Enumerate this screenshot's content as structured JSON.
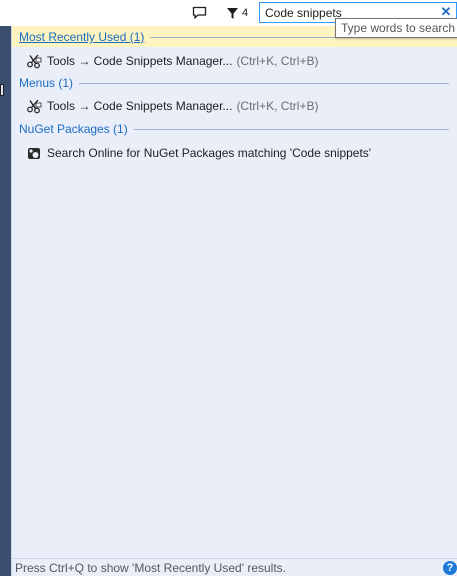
{
  "search": {
    "value": "Code snippets",
    "tooltip": "Type words to search f",
    "notification_count": "4"
  },
  "sections": [
    {
      "title": "Most Recently Used (1)",
      "results": [
        {
          "text": "Tools → Code Snippets Manager...",
          "shortcut": "(Ctrl+K, Ctrl+B)",
          "icon": "snippet-icon"
        }
      ]
    },
    {
      "title": "Menus (1)",
      "results": [
        {
          "text": "Tools → Code Snippets Manager...",
          "shortcut": "(Ctrl+K, Ctrl+B)",
          "icon": "snippet-icon"
        }
      ]
    },
    {
      "title": "NuGet Packages (1)",
      "results": [
        {
          "text": "Search Online for NuGet Packages matching 'Code snippets'",
          "shortcut": "",
          "icon": "nuget-icon"
        }
      ]
    }
  ],
  "footer": {
    "hint": "Press Ctrl+Q to show 'Most Recently Used' results.",
    "help_label": "?"
  },
  "colors": {
    "accent": "#1c6cc4",
    "panel_bg": "#e9eef9",
    "mru_highlight": "#fdf4bf",
    "search_border": "#3399ff"
  }
}
